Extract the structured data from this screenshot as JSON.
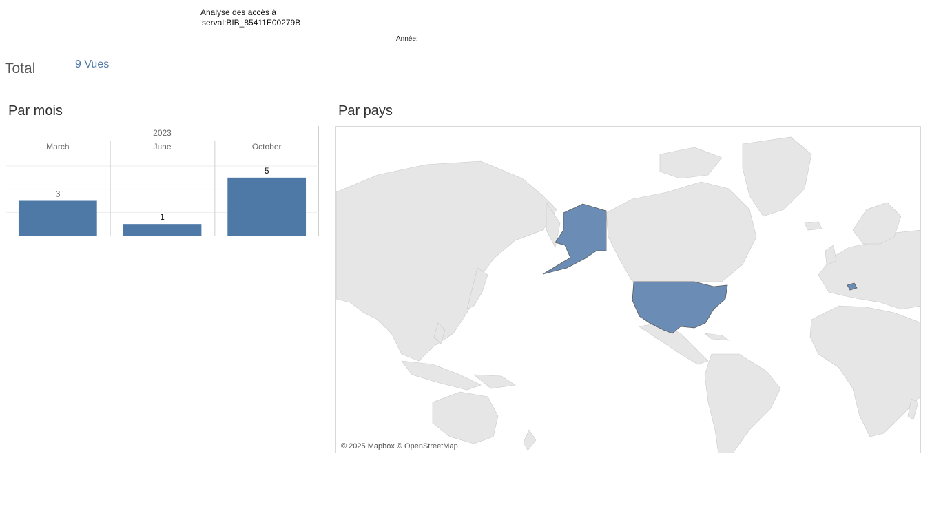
{
  "header": {
    "title_line1": "Analyse des accès à",
    "title_line2": "serval:BIB_85411E00279B",
    "year_filter_label": "Année:"
  },
  "summary": {
    "total_label": "Total",
    "total_value": "9 Vues"
  },
  "sections": {
    "by_month_title": "Par mois",
    "by_country_title": "Par pays"
  },
  "chart_data": {
    "type": "bar",
    "title": "Par mois",
    "header_group": "2023",
    "categories": [
      "March",
      "June",
      "October"
    ],
    "values": [
      3,
      1,
      5
    ],
    "ylim": [
      0,
      6
    ],
    "grid": true,
    "bar_color": "#4e79a7"
  },
  "map": {
    "attribution": "© 2025 Mapbox © OpenStreetMap",
    "highlighted_countries": [
      "United States",
      "Switzerland"
    ],
    "highlight_color": "#6b8db5",
    "land_color": "#e6e6e6",
    "water_color": "#ffffff"
  }
}
